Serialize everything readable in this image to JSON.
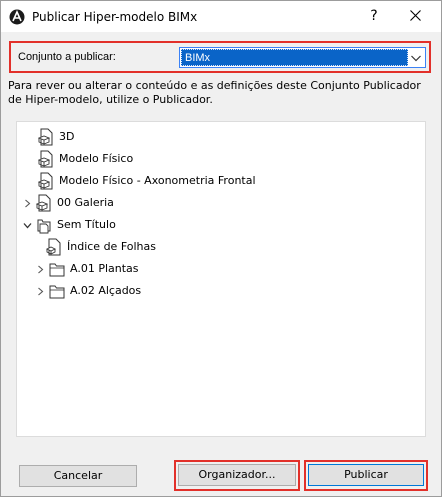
{
  "window": {
    "title": "Publicar Hiper-modelo BIMx",
    "help_glyph": "?",
    "close_glyph": "✕"
  },
  "publish_set": {
    "label": "Conjunto a publicar:",
    "selected_value": "BIMx"
  },
  "description": "Para rever ou alterar o conteúdo e as definições deste Conjunto Publicador de Hiper-modelo, utilize o Publicador.",
  "tree": {
    "items": [
      {
        "label": "3D",
        "icon": "view-3d-icon",
        "expander": "none"
      },
      {
        "label": "Modelo Físico",
        "icon": "view-3d-icon",
        "expander": "none"
      },
      {
        "label": "Modelo Físico - Axonometria Frontal",
        "icon": "view-3d-icon",
        "expander": "none"
      },
      {
        "label": "00 Galeria",
        "icon": "view-3d-icon",
        "expander": "collapsed"
      },
      {
        "label": "Sem Título",
        "icon": "layout-book-icon",
        "expander": "expanded"
      },
      {
        "label": "Índice de Folhas",
        "icon": "sheet-index-icon",
        "expander": "none"
      },
      {
        "label": "A.01 Plantas",
        "icon": "folder-icon",
        "expander": "collapsed"
      },
      {
        "label": "A.02 Alçados",
        "icon": "folder-icon",
        "expander": "collapsed"
      }
    ]
  },
  "buttons": {
    "cancel": "Cancelar",
    "organizer": "Organizador...",
    "publish": "Publicar"
  },
  "colors": {
    "highlight_red": "#e2302a",
    "selection_blue": "#0a64c8",
    "focus_blue": "#0078d7"
  }
}
